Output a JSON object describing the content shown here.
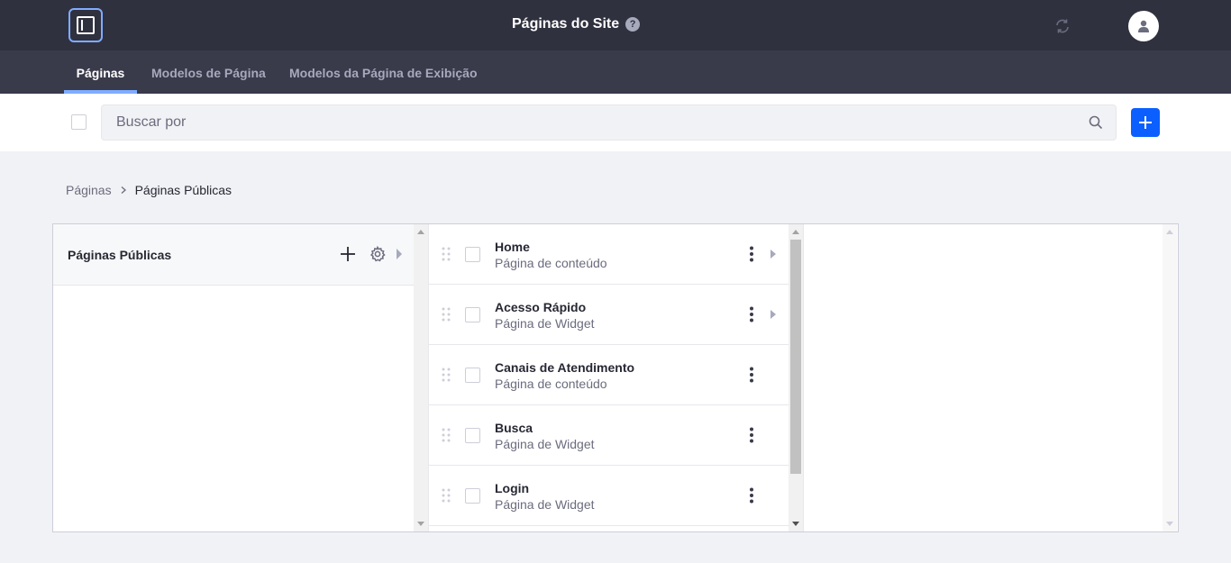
{
  "header": {
    "title": "Páginas do Site",
    "help_symbol": "?",
    "sidebar_toggle_icon": "sidebar-panel-icon",
    "sync_icon": "sync-icon",
    "avatar_icon": "user-icon"
  },
  "tabs": [
    {
      "label": "Páginas",
      "active": true
    },
    {
      "label": "Modelos de Página",
      "active": false
    },
    {
      "label": "Modelos da Página de Exibição",
      "active": false
    }
  ],
  "toolbar": {
    "search_placeholder": "Buscar por",
    "search_value": "",
    "add_icon": "plus-icon"
  },
  "breadcrumb": {
    "parent": "Páginas",
    "current": "Páginas Públicas"
  },
  "columns": {
    "root": {
      "title": "Páginas Públicas"
    },
    "pages": [
      {
        "title": "Home",
        "type": "Página de conteúdo",
        "has_children": true
      },
      {
        "title": "Acesso Rápido",
        "type": "Página de Widget",
        "has_children": true
      },
      {
        "title": "Canais de Atendimento",
        "type": "Página de conteúdo",
        "has_children": false
      },
      {
        "title": "Busca",
        "type": "Página de Widget",
        "has_children": false
      },
      {
        "title": "Login",
        "type": "Página de Widget",
        "has_children": false
      }
    ]
  },
  "colors": {
    "topbar": "#30313f",
    "tabbar": "#393a4a",
    "primary": "#0b5fff",
    "accent": "#80acff"
  }
}
